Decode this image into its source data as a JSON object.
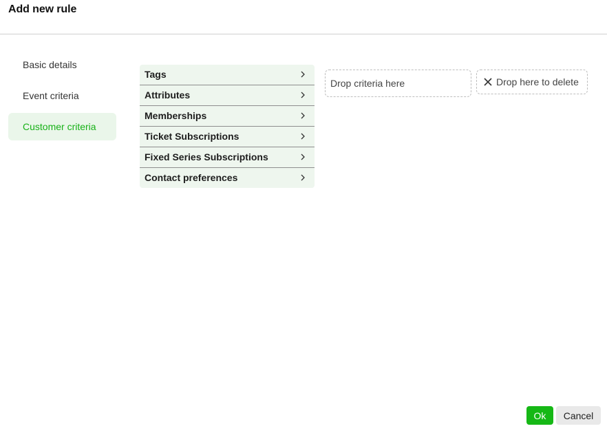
{
  "dialog": {
    "title": "Add new rule"
  },
  "sidebar": {
    "items": [
      {
        "label": "Basic details"
      },
      {
        "label": "Event criteria"
      },
      {
        "label": "Customer criteria"
      }
    ]
  },
  "criteria": {
    "items": [
      {
        "label": "Tags"
      },
      {
        "label": "Attributes"
      },
      {
        "label": "Memberships"
      },
      {
        "label": "Ticket Subscriptions"
      },
      {
        "label": "Fixed Series Subscriptions"
      },
      {
        "label": "Contact preferences"
      }
    ]
  },
  "dropzone": {
    "label": "Drop criteria here"
  },
  "deletezone": {
    "label": "Drop here to delete",
    "icon": "close-icon"
  },
  "footer": {
    "ok_label": "Ok",
    "cancel_label": "Cancel"
  },
  "colors": {
    "accent": "#16b816",
    "active_bg": "#eaf6ea",
    "criteria_bg": "#eef6ee"
  }
}
